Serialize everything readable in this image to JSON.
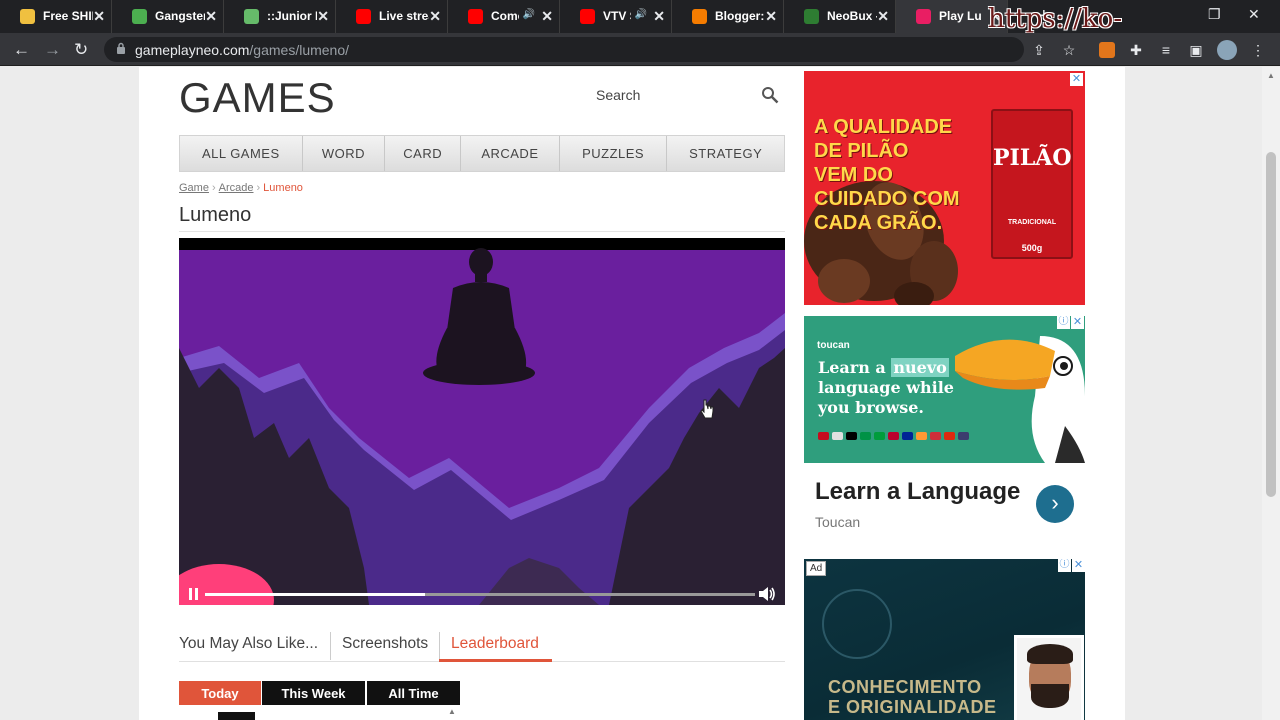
{
  "browser": {
    "tabs": [
      {
        "title": "Free SHIB",
        "favicon_color": "#f0c040",
        "speaker": false,
        "active": false
      },
      {
        "title": "Gangster V",
        "favicon_color": "#4caf50",
        "speaker": false,
        "active": false
      },
      {
        "title": "::Junior M",
        "favicon_color": "#66bb6a",
        "speaker": false,
        "active": false
      },
      {
        "title": "Live stream",
        "favicon_color": "#ff0000",
        "speaker": false,
        "active": false
      },
      {
        "title": "Como",
        "favicon_color": "#ff0000",
        "speaker": true,
        "active": false
      },
      {
        "title": "VTV SI",
        "favicon_color": "#ff0000",
        "speaker": true,
        "active": false
      },
      {
        "title": "Blogger: P",
        "favicon_color": "#f57c00",
        "speaker": false,
        "active": false
      },
      {
        "title": "NeoBux - A",
        "favicon_color": "#2e7d32",
        "speaker": false,
        "active": false
      },
      {
        "title": "Play Lu",
        "favicon_color": "#e91e63",
        "speaker": false,
        "active": true
      }
    ],
    "overlay_text": "https://ko-fi.com/gokagen",
    "url_host": "gameplayneo.com",
    "url_path": "/games/lumeno/"
  },
  "site": {
    "logo": "GAMES",
    "search_label": "Search",
    "categories": [
      "ALL GAMES",
      "WORD",
      "CARD",
      "ARCADE",
      "PUZZLES",
      "STRATEGY"
    ],
    "breadcrumb": {
      "game": "Game",
      "arcade": "Arcade",
      "current": "Lumeno"
    },
    "game_title": "Lumeno"
  },
  "player": {
    "progress": 0.4,
    "colors": {
      "sky": "#6a1f9e",
      "mountains_light": "#7a52c9",
      "mountains_dark": "#2a2033",
      "accent": "#ff3f7a"
    }
  },
  "tabs": {
    "items": [
      "You May Also Like...",
      "Screenshots",
      "Leaderboard"
    ],
    "active": "Leaderboard",
    "accent": "#e0553a"
  },
  "leaderboard_periods": [
    {
      "label": "Today",
      "color": "#e0553a"
    },
    {
      "label": "This Week",
      "color": "#111111"
    },
    {
      "label": "All Time",
      "color": "#111111"
    }
  ],
  "ads": {
    "ad1": {
      "headline_lines": [
        "A QUALIDADE",
        "DE PILÃO",
        "VEM DO",
        "CUIDADO COM",
        "CADA GRÃO."
      ],
      "brand": "PILÃO",
      "pack_sub": "TRADICIONAL",
      "pack_weight": "500g"
    },
    "ad2": {
      "brand": "toucan",
      "headline_before": "Learn a ",
      "headline_highlight": "nuevo",
      "headline_after": "language while you browse.",
      "title": "Learn a Language",
      "advertiser": "Toucan"
    },
    "ad3": {
      "badge": "Ad",
      "headline_lines": [
        "CONHECIMENTO",
        "E ORIGINALIDADE"
      ]
    }
  }
}
